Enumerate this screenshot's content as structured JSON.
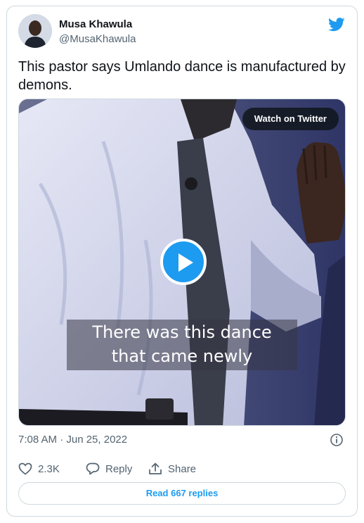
{
  "user": {
    "display_name": "Musa Khawula",
    "handle": "@MusaKhawula"
  },
  "tweet": {
    "text": "This pastor says Umlando dance is manufactured by demons.",
    "timestamp": "7:08 AM · Jun 25, 2022"
  },
  "media": {
    "watch_label": "Watch on Twitter",
    "caption_line1": "There was this dance",
    "caption_line2": "that came newly"
  },
  "actions": {
    "like_count": "2.3K",
    "reply_label": "Reply",
    "share_label": "Share"
  },
  "read_replies_label": "Read 667 replies",
  "colors": {
    "brand": "#1d9bf0",
    "text_primary": "#0f1419",
    "text_secondary": "#536471",
    "border": "#cfd9de"
  },
  "icons": {
    "brand": "twitter-bird-icon",
    "info": "info-icon",
    "like": "heart-icon",
    "reply": "reply-bubble-icon",
    "share": "share-upload-icon",
    "play": "play-icon"
  }
}
